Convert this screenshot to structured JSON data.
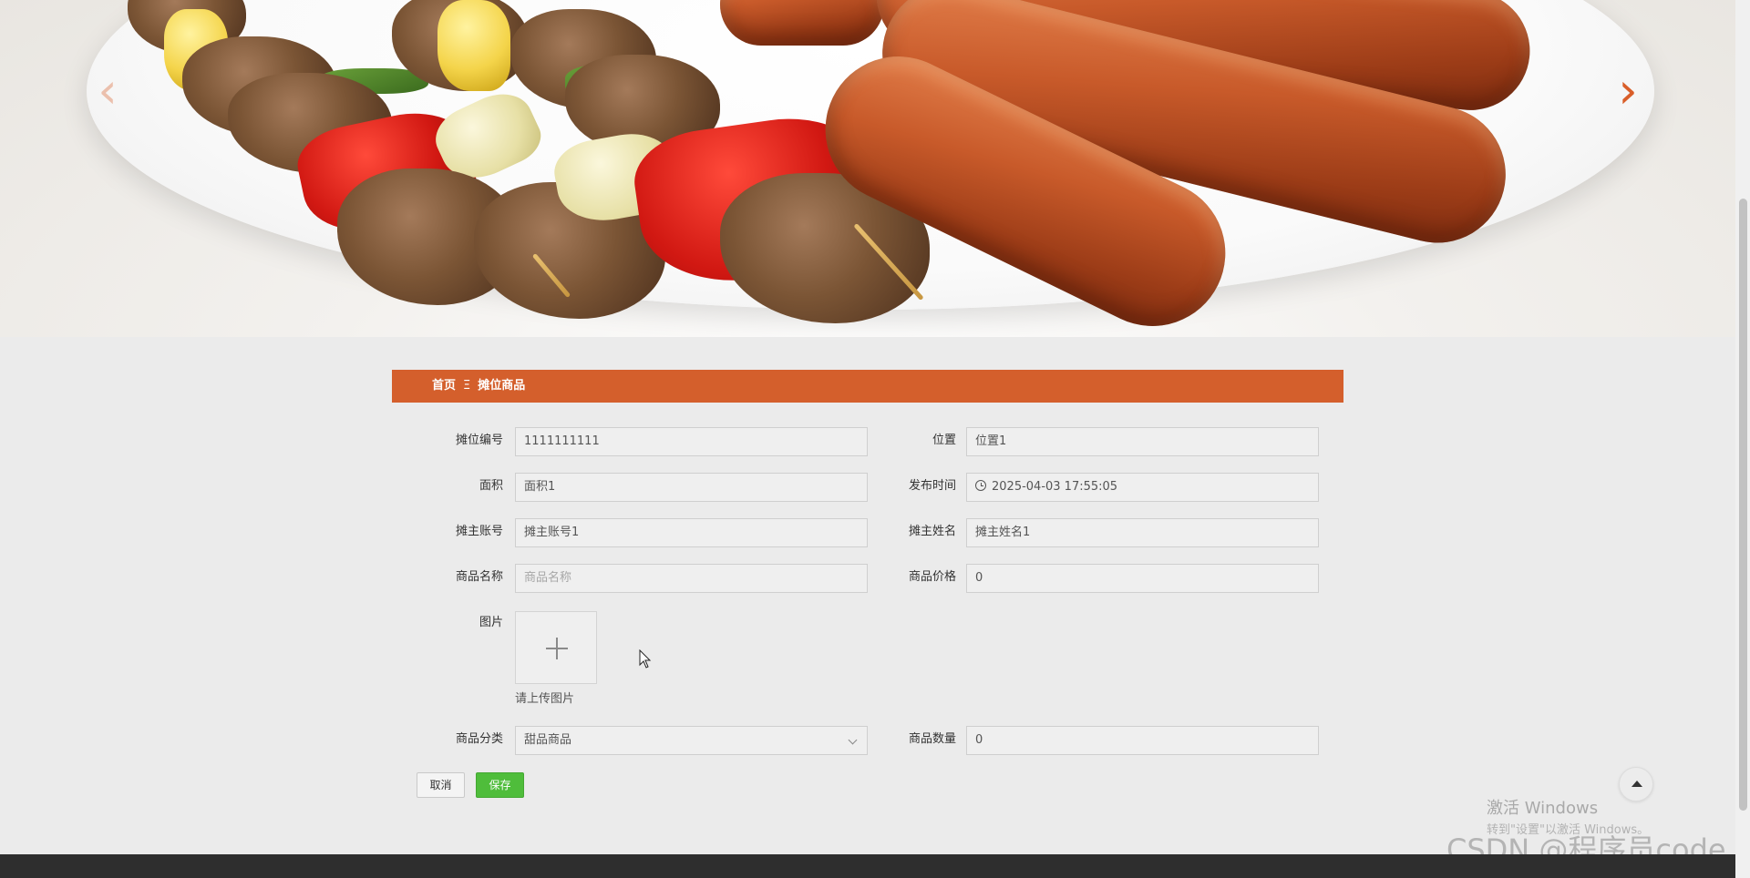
{
  "banner": {
    "prev_arrow": "‹",
    "next_arrow": "›"
  },
  "breadcrumb": {
    "home": "首页",
    "separator": "Ξ",
    "current": "摊位商品"
  },
  "form": {
    "stall_no": {
      "label": "摊位编号",
      "value": "1111111111"
    },
    "location": {
      "label": "位置",
      "value": "位置1"
    },
    "area": {
      "label": "面积",
      "value": "面积1"
    },
    "publish_time": {
      "label": "发布时间",
      "value": "2025-04-03 17:55:05"
    },
    "owner_account": {
      "label": "摊主账号",
      "value": "摊主账号1"
    },
    "owner_name": {
      "label": "摊主姓名",
      "value": "摊主姓名1"
    },
    "product_name": {
      "label": "商品名称",
      "placeholder": "商品名称"
    },
    "product_price": {
      "label": "商品价格",
      "value": "0"
    },
    "image": {
      "label": "图片",
      "hint": "请上传图片"
    },
    "category": {
      "label": "商品分类",
      "value": "甜品商品"
    },
    "quantity": {
      "label": "商品数量",
      "value": "0"
    }
  },
  "buttons": {
    "cancel": "取消",
    "save": "保存"
  },
  "watermark": {
    "line1": "激活 Windows",
    "line2": "转到\"设置\"以激活 Windows。",
    "csdn": "CSDN @程序员code"
  },
  "colors": {
    "accent": "#d45f2c",
    "save_button": "#4fbd3b",
    "footer": "#2e2e2e"
  }
}
